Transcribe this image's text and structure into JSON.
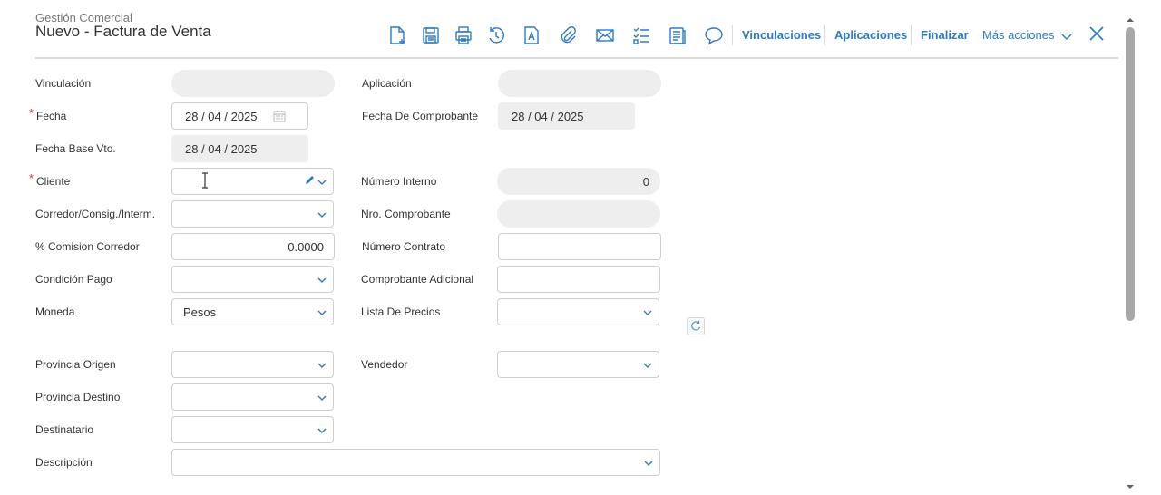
{
  "header": {
    "subtitle": "Gestión Comercial",
    "title": "Nuevo - Factura de Venta"
  },
  "toolbar": {
    "icons": [
      "new-document-icon",
      "save-icon",
      "print-icon",
      "refresh-history-icon",
      "text-format-icon",
      "attachment-icon",
      "email-icon",
      "checklist-icon",
      "notes-icon",
      "comment-icon",
      "close-icon"
    ],
    "links": {
      "vinculaciones": "Vinculaciones",
      "aplicaciones": "Aplicaciones",
      "finalizar": "Finalizar",
      "mas_acciones": "Más acciones"
    },
    "accent_color": "#2d7bc4"
  },
  "form": {
    "required_mark": "*",
    "vinculacion": {
      "label": "Vinculación",
      "value": ""
    },
    "aplicacion": {
      "label": "Aplicación",
      "value": ""
    },
    "fecha": {
      "label": "Fecha",
      "value": "28 / 04 / 2025"
    },
    "fecha_comprobante": {
      "label": "Fecha De Comprobante",
      "value": "28 / 04 / 2025"
    },
    "fecha_base_vto": {
      "label": "Fecha Base Vto.",
      "value": "28 / 04 / 2025"
    },
    "cliente": {
      "label": "Cliente",
      "value": ""
    },
    "numero_interno": {
      "label": "Número Interno",
      "value": "0"
    },
    "corredor": {
      "label": "Corredor/Consig./Interm.",
      "value": ""
    },
    "nro_comprobante": {
      "label": "Nro. Comprobante",
      "value": ""
    },
    "comision_corredor": {
      "label": "% Comision Corredor",
      "value": "0.0000"
    },
    "numero_contrato": {
      "label": "Número Contrato",
      "value": ""
    },
    "condicion_pago": {
      "label": "Condición Pago",
      "value": ""
    },
    "comprobante_adicional": {
      "label": "Comprobante Adicional",
      "value": ""
    },
    "moneda": {
      "label": "Moneda",
      "value": "Pesos"
    },
    "lista_precios": {
      "label": "Lista De Precios",
      "value": ""
    },
    "provincia_origen": {
      "label": "Provincia Origen",
      "value": ""
    },
    "vendedor": {
      "label": "Vendedor",
      "value": ""
    },
    "provincia_destino": {
      "label": "Provincia Destino",
      "value": ""
    },
    "destinatario": {
      "label": "Destinatario",
      "value": ""
    },
    "descripcion": {
      "label": "Descripción",
      "value": ""
    }
  }
}
